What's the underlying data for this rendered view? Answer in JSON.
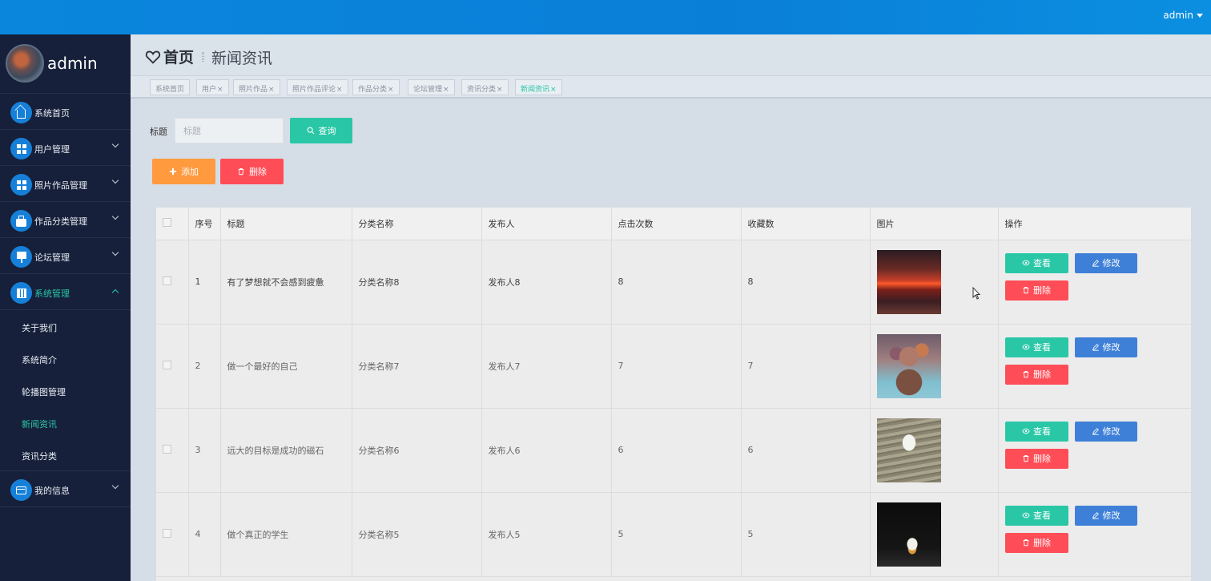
{
  "topbar": {
    "user": "admin"
  },
  "sidebar": {
    "brand": "admin",
    "menu": [
      {
        "label": "系统首页",
        "icon": "home-icon",
        "expand": "none"
      },
      {
        "label": "用户管理",
        "icon": "grid-icon",
        "expand": "down"
      },
      {
        "label": "照片作品管理",
        "icon": "grid-icon",
        "expand": "down"
      },
      {
        "label": "作品分类管理",
        "icon": "briefcase-icon",
        "expand": "down"
      },
      {
        "label": "论坛管理",
        "icon": "board-icon",
        "expand": "down"
      },
      {
        "label": "系统管理",
        "icon": "table-icon",
        "expand": "up"
      },
      {
        "label": "我的信息",
        "icon": "card-icon",
        "expand": "down"
      }
    ],
    "submenu": [
      "关于我们",
      "系统简介",
      "轮播图管理",
      "新闻资讯",
      "资讯分类"
    ]
  },
  "breadcrumb": {
    "home": "首页",
    "current": "新闻资讯"
  },
  "tabs": [
    "系统首页",
    "用户",
    "照片作品",
    "照片作品评论",
    "作品分类",
    "论坛管理",
    "资讯分类",
    "新闻资讯"
  ],
  "search": {
    "label": "标题",
    "placeholder": "标题",
    "button": "查询"
  },
  "actions": {
    "add": "添加",
    "delete": "删除"
  },
  "table": {
    "headers": [
      "序号",
      "标题",
      "分类名称",
      "发布人",
      "点击次数",
      "收藏数",
      "图片",
      "操作"
    ],
    "rows": [
      {
        "no": "1",
        "title": "有了梦想就不会感到疲惫",
        "category": "分类名称8",
        "publisher": "发布人8",
        "clicks": "8",
        "favorites": "8"
      },
      {
        "no": "2",
        "title": "做一个最好的自己",
        "category": "分类名称7",
        "publisher": "发布人7",
        "clicks": "7",
        "favorites": "7"
      },
      {
        "no": "3",
        "title": "远大的目标是成功的磁石",
        "category": "分类名称6",
        "publisher": "发布人6",
        "clicks": "6",
        "favorites": "6"
      },
      {
        "no": "4",
        "title": "做个真正的学生",
        "category": "分类名称5",
        "publisher": "发布人5",
        "clicks": "5",
        "favorites": "5"
      }
    ],
    "row_actions": {
      "view": "查看",
      "edit": "修改",
      "delete": "删除"
    }
  },
  "colors": {
    "accent": "#2ac7a7",
    "primary_blue": "#3e80d8",
    "danger": "#ff4d57",
    "warning": "#ff9a3e",
    "sidebar_bg": "#16203a",
    "topbar": "#0a86dd"
  }
}
